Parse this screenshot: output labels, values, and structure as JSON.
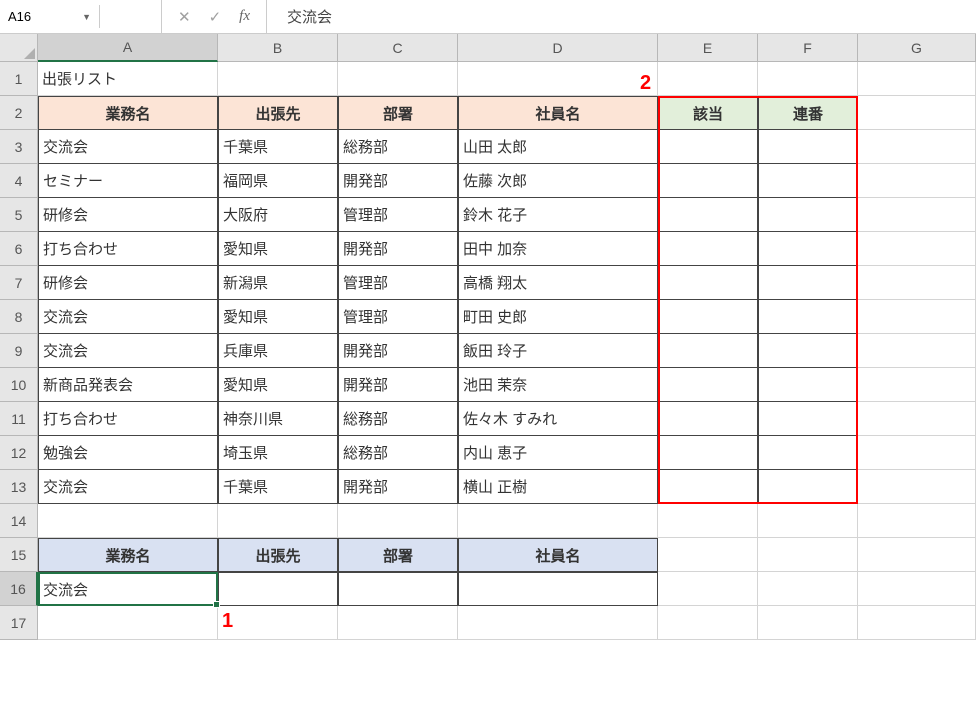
{
  "nameBox": "A16",
  "formulaValue": "交流会",
  "columns": [
    "A",
    "B",
    "C",
    "D",
    "E",
    "F",
    "G"
  ],
  "rows": [
    "1",
    "2",
    "3",
    "4",
    "5",
    "6",
    "7",
    "8",
    "9",
    "10",
    "11",
    "12",
    "13",
    "14",
    "15",
    "16",
    "17"
  ],
  "activeCol": "A",
  "activeRow": "16",
  "title": "出張リスト",
  "headers1": {
    "a": "業務名",
    "b": "出張先",
    "c": "部署",
    "d": "社員名",
    "e": "該当",
    "f": "連番"
  },
  "tableData": [
    {
      "a": "交流会",
      "b": "千葉県",
      "c": "総務部",
      "d": "山田 太郎"
    },
    {
      "a": "セミナー",
      "b": "福岡県",
      "c": "開発部",
      "d": "佐藤 次郎"
    },
    {
      "a": "研修会",
      "b": "大阪府",
      "c": "管理部",
      "d": "鈴木 花子"
    },
    {
      "a": "打ち合わせ",
      "b": "愛知県",
      "c": "開発部",
      "d": "田中 加奈"
    },
    {
      "a": "研修会",
      "b": "新潟県",
      "c": "管理部",
      "d": "高橋 翔太"
    },
    {
      "a": "交流会",
      "b": "愛知県",
      "c": "管理部",
      "d": "町田 史郎"
    },
    {
      "a": "交流会",
      "b": "兵庫県",
      "c": "開発部",
      "d": "飯田 玲子"
    },
    {
      "a": "新商品発表会",
      "b": "愛知県",
      "c": "開発部",
      "d": "池田 茉奈"
    },
    {
      "a": "打ち合わせ",
      "b": "神奈川県",
      "c": "総務部",
      "d": "佐々木 すみれ"
    },
    {
      "a": "勉強会",
      "b": "埼玉県",
      "c": "総務部",
      "d": "内山 恵子"
    },
    {
      "a": "交流会",
      "b": "千葉県",
      "c": "開発部",
      "d": "横山 正樹"
    }
  ],
  "headers2": {
    "a": "業務名",
    "b": "出張先",
    "c": "部署",
    "d": "社員名"
  },
  "inputRow": {
    "a": "交流会"
  },
  "annotations": {
    "a1": "1",
    "a2": "2"
  }
}
